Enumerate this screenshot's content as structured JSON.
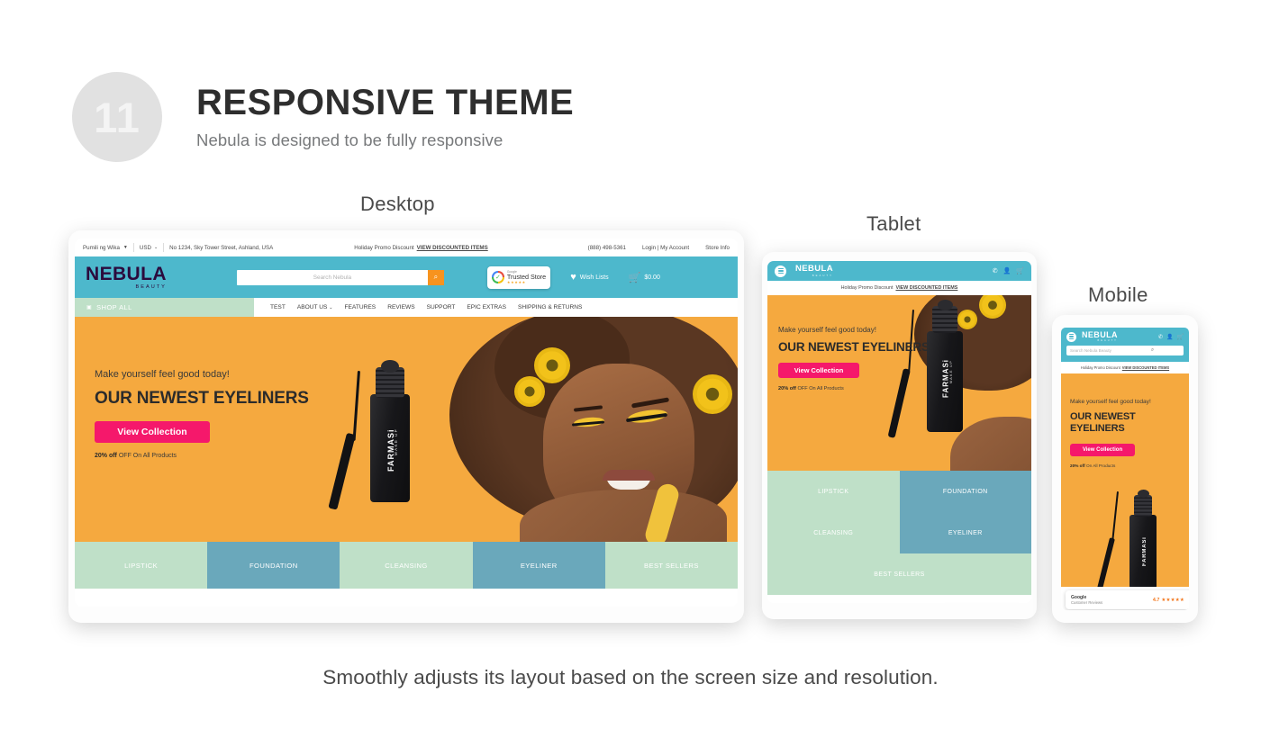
{
  "header": {
    "number": "11",
    "title": "RESPONSIVE THEME",
    "subtitle": "Nebula is designed to be fully responsive"
  },
  "caption": "Smoothly adjusts its layout based on the screen size and resolution.",
  "devices": {
    "desktop_label": "Desktop",
    "tablet_label": "Tablet",
    "mobile_label": "Mobile"
  },
  "site": {
    "topbar": {
      "language": "Pumili ng Wika",
      "currency": "USD",
      "address": "No 1234, Sky Tower Street, Ashland, USA",
      "promo_text": "Holiday Promo Discount",
      "promo_link": "VIEW DISCOUNTED ITEMS",
      "phone": "(888) 498-5361",
      "account": "Login | My Account",
      "store_info": "Store Info"
    },
    "brand": {
      "name": "NEBULA",
      "tagline": "BEAUTY"
    },
    "search": {
      "placeholder_desktop": "Search Nebula",
      "placeholder_mobile": "Search Nebula Beauty",
      "icon": "search-icon"
    },
    "utility": {
      "trusted_small": "Google",
      "trusted_label": "Trusted Store",
      "wishlist": "Wish Lists",
      "cart_total": "$0.00"
    },
    "nav": {
      "shop_all": "SHOP ALL",
      "items": [
        "TEST",
        "ABOUT US",
        "FEATURES",
        "REVIEWS",
        "SUPPORT",
        "EPIC EXTRAS",
        "SHIPPING & RETURNS"
      ]
    },
    "hero": {
      "kicker": "Make yourself feel good today!",
      "title": "OUR NEWEST EYELINERS",
      "title_line1": "OUR NEWEST",
      "title_line2": "EYELINERS",
      "button": "View Collection",
      "note_bold": "20% off",
      "note_rest": "OFF On All Products",
      "note_mobile_rest": "On All Products",
      "product_brand": "FARMASi",
      "product_sub": "MAKE UP"
    },
    "categories": [
      {
        "label": "LIPSTICK",
        "style": "green"
      },
      {
        "label": "FOUNDATION",
        "style": "teal"
      },
      {
        "label": "CLEANSING",
        "style": "green"
      },
      {
        "label": "EYELINER",
        "style": "teal"
      },
      {
        "label": "BEST SELLERS",
        "style": "green"
      }
    ],
    "google_reviews": {
      "title": "Google",
      "subtitle": "Customer Reviews",
      "score": "4.7",
      "stars": "★★★★★"
    },
    "mobile_icons": {
      "menu": "hamburger-icon",
      "phone": "phone-icon",
      "user": "user-icon",
      "cart": "cart-icon"
    }
  },
  "colors": {
    "teal": "#4db8cc",
    "orange": "#f5a93f",
    "pink": "#f5186b",
    "green": "#bfe0c8",
    "teal_cat": "#6aa8bb",
    "search_btn": "#f7931e"
  }
}
